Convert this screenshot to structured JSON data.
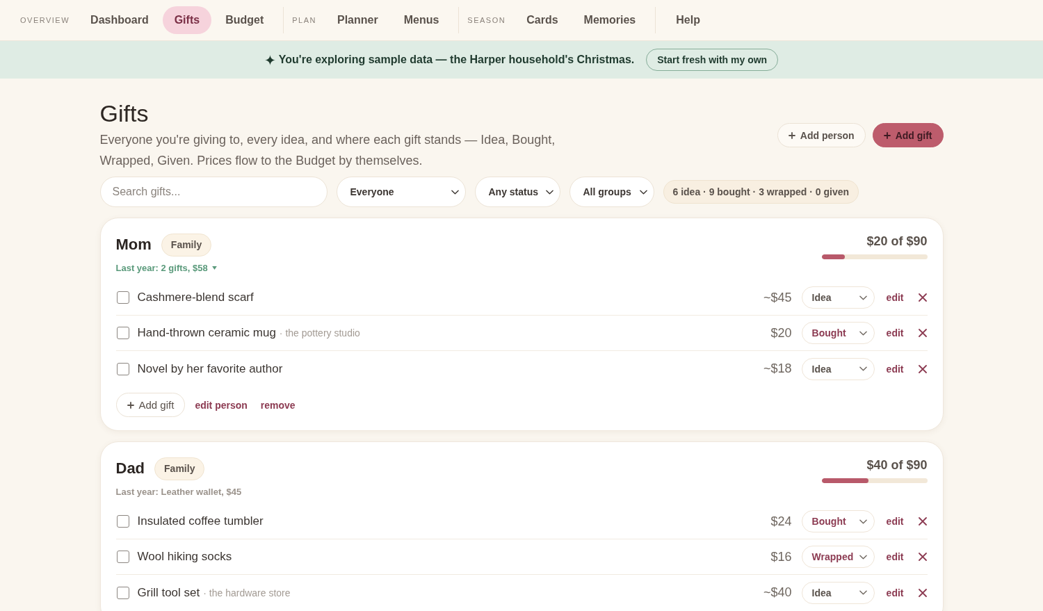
{
  "nav": {
    "groups": [
      {
        "label": "OVERVIEW",
        "items": [
          {
            "label": "Dashboard",
            "selected": false
          },
          {
            "label": "Gifts",
            "selected": true
          },
          {
            "label": "Budget",
            "selected": false
          }
        ]
      },
      {
        "label": "PLAN",
        "items": [
          {
            "label": "Planner",
            "selected": false
          },
          {
            "label": "Menus",
            "selected": false
          }
        ]
      },
      {
        "label": "SEASON",
        "items": [
          {
            "label": "Cards",
            "selected": false
          },
          {
            "label": "Memories",
            "selected": false
          }
        ]
      },
      {
        "items": [
          {
            "label": "Help",
            "selected": false
          }
        ]
      }
    ]
  },
  "banner": {
    "message": "You're exploring sample data — the Harper household's Christmas.",
    "button": "Start fresh with my own"
  },
  "header": {
    "title": "Gifts",
    "description": "Everyone you're giving to, every idea, and where each gift stands — Idea, Bought, Wrapped, Given. Prices flow to the Budget by themselves.",
    "actions": [
      {
        "label": "Add person",
        "kind": "secondary"
      },
      {
        "label": "Add gift",
        "kind": "primary"
      }
    ]
  },
  "filters": {
    "search": {
      "placeholder": "Search gifts..."
    },
    "selects": [
      {
        "value": "Everyone"
      },
      {
        "value": "Any status"
      },
      {
        "value": "All groups"
      }
    ],
    "summary": "6 idea · 9 bought · 3 wrapped · 0 given"
  },
  "people": [
    {
      "name": "Mom",
      "tag": "Family",
      "last_year": {
        "text": "Last year: 2 gifts, $58",
        "expandable": true
      },
      "total": "$20 of $90",
      "level": 0.222,
      "gifts": [
        {
          "name": "Cashmere-blend scarf",
          "checked": false,
          "price": "~$45",
          "status": {
            "label": "Idea",
            "kind": "idea"
          },
          "action": "edit"
        },
        {
          "name": "Hand-thrown ceramic mug",
          "note": "· the pottery studio",
          "checked": false,
          "price": "$20",
          "status": {
            "label": "Bought",
            "kind": "bought"
          },
          "action": "edit"
        },
        {
          "name": "Novel by her favorite author",
          "checked": false,
          "price": "~$18",
          "status": {
            "label": "Idea",
            "kind": "idea"
          },
          "action": "edit"
        }
      ],
      "footer": {
        "add": "Add gift",
        "links": [
          "edit person",
          "remove"
        ]
      }
    },
    {
      "name": "Dad",
      "tag": "Family",
      "last_year": {
        "text": "Last year: Leather wallet, $45",
        "expandable": false
      },
      "total": "$40 of $90",
      "level": 0.444,
      "gifts": [
        {
          "name": "Insulated coffee tumbler",
          "checked": false,
          "price": "$24",
          "status": {
            "label": "Bought",
            "kind": "bought"
          },
          "action": "edit"
        },
        {
          "name": "Wool hiking socks",
          "checked": false,
          "price": "$16",
          "status": {
            "label": "Wrapped",
            "kind": "wrapped"
          },
          "action": "edit"
        },
        {
          "name": "Grill tool set",
          "note": "· the hardware store",
          "checked": false,
          "price": "~$40",
          "status": {
            "label": "Idea",
            "kind": "idea"
          },
          "action": "edit"
        }
      ]
    }
  ]
}
